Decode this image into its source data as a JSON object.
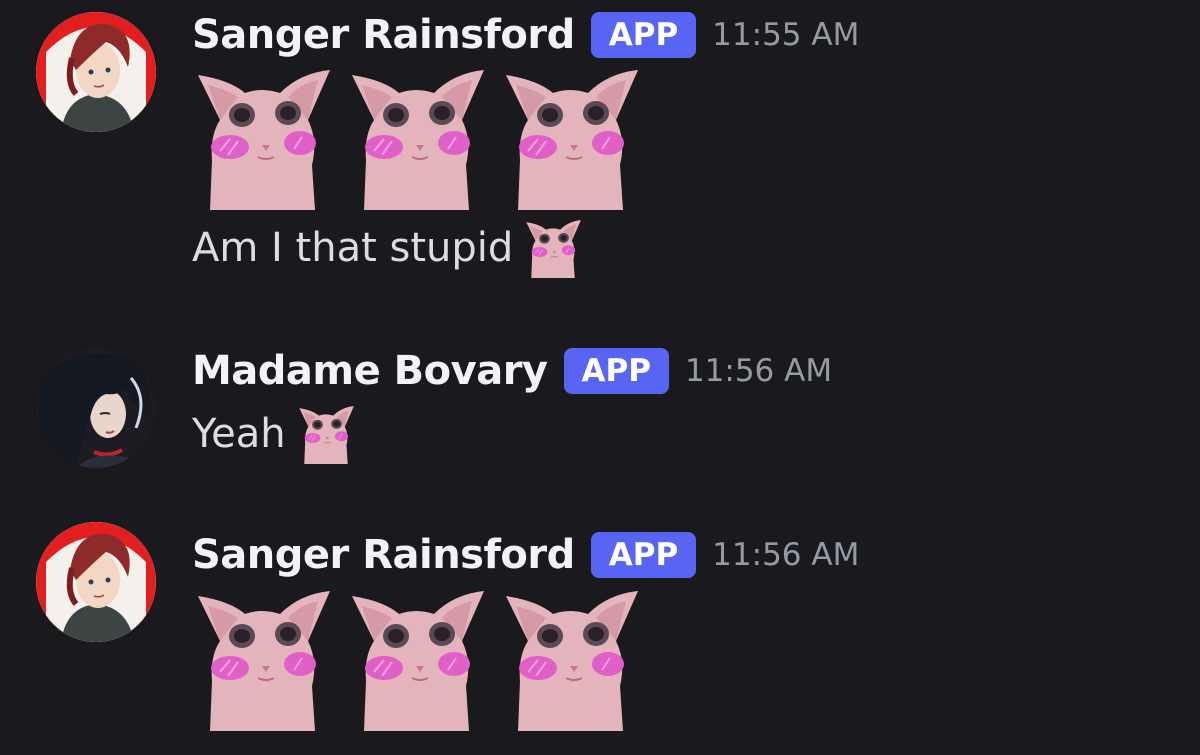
{
  "messages": [
    {
      "username": "Sanger Rainsford",
      "badge": "APP",
      "timestamp": "11:55 AM",
      "avatar_icon": "anime-red-haired-man-avatar",
      "stickers": [
        "pink-cat-blush-sticker",
        "pink-cat-blush-sticker",
        "pink-cat-blush-sticker"
      ],
      "text": "Am I that stupid",
      "inline_emoji": "pink-cat-blush-emoji"
    },
    {
      "username": "Madame Bovary",
      "badge": "APP",
      "timestamp": "11:56 AM",
      "avatar_icon": "anime-dark-haired-woman-avatar",
      "text": "Yeah",
      "inline_emoji": "pink-cat-blush-emoji"
    },
    {
      "username": "Sanger Rainsford",
      "badge": "APP",
      "timestamp": "11:56 AM",
      "avatar_icon": "anime-red-haired-man-avatar",
      "stickers": [
        "pink-cat-blush-sticker",
        "pink-cat-blush-sticker",
        "pink-cat-blush-sticker"
      ]
    }
  ],
  "colors": {
    "background": "#1a1a1e",
    "username": "#f2f3f5",
    "badge": "#5865f2",
    "timestamp": "#949ba4",
    "text": "#dbdee1",
    "cat_pink": "#e8b8c0",
    "blush": "#e060c8"
  }
}
